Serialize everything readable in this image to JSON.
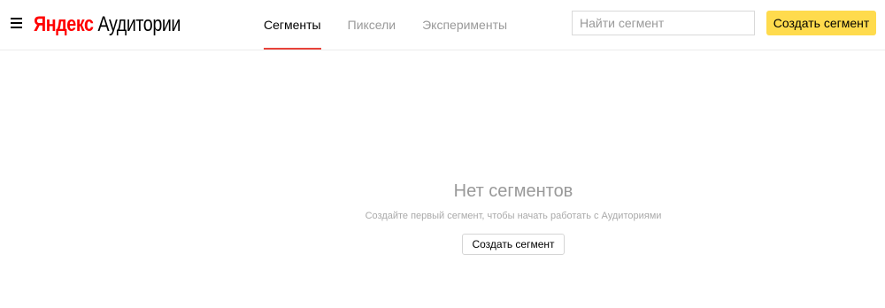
{
  "header": {
    "menu_icon": "hamburger-menu-icon",
    "logo": {
      "brand": "Яндекс",
      "product": "Аудитории",
      "brand_color": "#ff0000"
    },
    "tabs": [
      {
        "label": "Сегменты",
        "active": true
      },
      {
        "label": "Пиксели",
        "active": false
      },
      {
        "label": "Эксперименты",
        "active": false
      }
    ],
    "search": {
      "placeholder": "Найти сегмент",
      "value": ""
    },
    "create_button": {
      "label": "Создать сегмент",
      "color": "#ffdb4d"
    },
    "active_tab_underline_color": "#e8423a"
  },
  "empty_state": {
    "title": "Нет сегментов",
    "description": "Создайте первый сегмент, чтобы начать работать с Аудиториями",
    "button_label": "Создать сегмент"
  }
}
